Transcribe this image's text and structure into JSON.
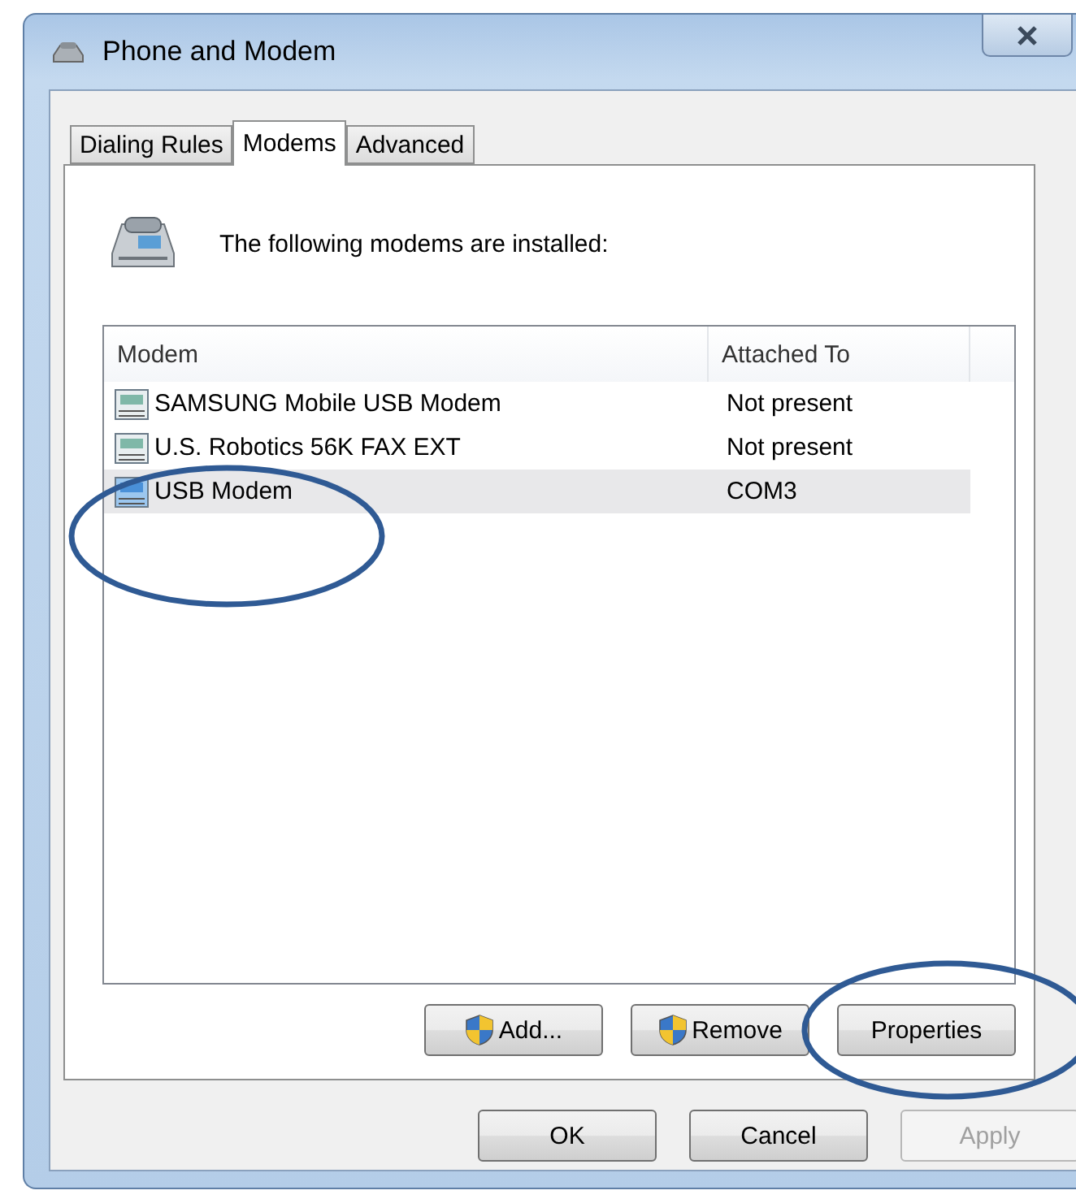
{
  "window": {
    "title": "Phone and Modem"
  },
  "tabs": [
    {
      "label": "Dialing Rules",
      "selected": false
    },
    {
      "label": "Modems",
      "selected": true
    },
    {
      "label": "Advanced",
      "selected": false
    }
  ],
  "intro": "The following modems are installed:",
  "table": {
    "columns": [
      "Modem",
      "Attached To"
    ],
    "rows": [
      {
        "modem": "SAMSUNG Mobile USB Modem",
        "attached_to": "Not present",
        "selected": false,
        "circled": false
      },
      {
        "modem": "U.S. Robotics 56K FAX EXT",
        "attached_to": "Not present",
        "selected": false,
        "circled": false
      },
      {
        "modem": "USB Modem",
        "attached_to": "COM3",
        "selected": true,
        "circled": true
      }
    ]
  },
  "panel_buttons": [
    {
      "label": "Add...",
      "shield": true,
      "circled": false
    },
    {
      "label": "Remove",
      "shield": true,
      "circled": false
    },
    {
      "label": "Properties",
      "shield": false,
      "circled": true
    }
  ],
  "dialog_buttons": [
    {
      "label": "OK",
      "disabled": false
    },
    {
      "label": "Cancel",
      "disabled": false
    },
    {
      "label": "Apply",
      "disabled": true
    }
  ]
}
